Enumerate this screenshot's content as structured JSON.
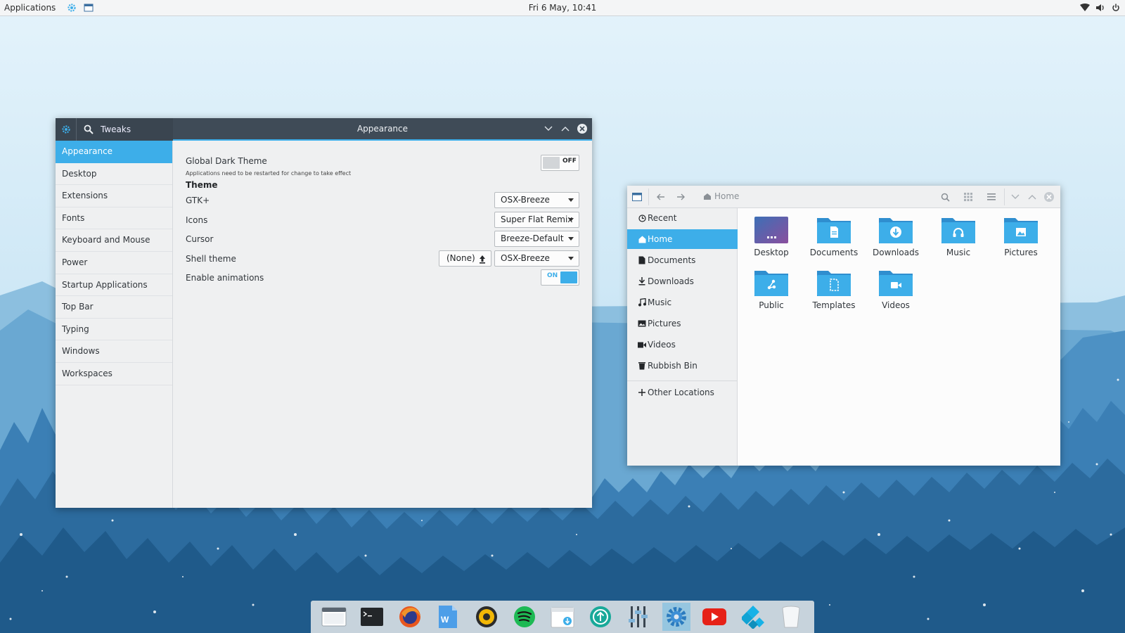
{
  "topbar": {
    "applications": "Applications",
    "clock": "Fri  6 May, 10:41",
    "icons": [
      "settings-icon",
      "files-icon",
      "wifi-icon",
      "volume-icon",
      "power-icon"
    ]
  },
  "tweaks": {
    "app_name": "Tweaks",
    "title": "Appearance",
    "sidebar": [
      {
        "label": "Appearance",
        "active": true
      },
      {
        "label": "Desktop"
      },
      {
        "label": "Extensions"
      },
      {
        "label": "Fonts"
      },
      {
        "label": "Keyboard and Mouse"
      },
      {
        "label": "Power"
      },
      {
        "label": "Startup Applications"
      },
      {
        "label": "Top Bar"
      },
      {
        "label": "Typing"
      },
      {
        "label": "Windows"
      },
      {
        "label": "Workspaces"
      }
    ],
    "global_dark_theme": {
      "label": "Global Dark Theme",
      "note": "Applications need to be restarted for change to take effect",
      "state": "OFF"
    },
    "theme_header": "Theme",
    "gtk": {
      "label": "GTK+",
      "value": "OSX-Breeze"
    },
    "icons": {
      "label": "Icons",
      "value": "Super Flat Remix"
    },
    "cursor": {
      "label": "Cursor",
      "value": "Breeze-Default"
    },
    "shell": {
      "label": "Shell theme",
      "button": "(None)",
      "value": "OSX-Breeze"
    },
    "animations": {
      "label": "Enable animations",
      "state": "ON"
    }
  },
  "files": {
    "location": "Home",
    "sidebar": [
      {
        "label": "Recent",
        "icon": "clock-icon"
      },
      {
        "label": "Home",
        "icon": "home-icon",
        "active": true
      },
      {
        "label": "Documents",
        "icon": "document-icon"
      },
      {
        "label": "Downloads",
        "icon": "download-icon"
      },
      {
        "label": "Music",
        "icon": "music-icon"
      },
      {
        "label": "Pictures",
        "icon": "picture-icon"
      },
      {
        "label": "Videos",
        "icon": "video-icon"
      },
      {
        "label": "Rubbish Bin",
        "icon": "trash-icon"
      }
    ],
    "other_locations": "Other Locations",
    "folders": [
      {
        "label": "Desktop",
        "icon": "desktop-folder-icon"
      },
      {
        "label": "Documents",
        "icon": "documents-folder-icon"
      },
      {
        "label": "Downloads",
        "icon": "downloads-folder-icon"
      },
      {
        "label": "Music",
        "icon": "music-folder-icon"
      },
      {
        "label": "Pictures",
        "icon": "pictures-folder-icon"
      },
      {
        "label": "Public",
        "icon": "public-folder-icon"
      },
      {
        "label": "Templates",
        "icon": "templates-folder-icon"
      },
      {
        "label": "Videos",
        "icon": "videos-folder-icon"
      }
    ]
  },
  "dock": [
    "files-icon",
    "terminal-icon",
    "firefox-icon",
    "writer-icon",
    "rhythmbox-icon",
    "spotify-icon",
    "calendar-icon",
    "update-icon",
    "mixer-icon",
    "settings-icon",
    "youtube-icon",
    "kodi-icon",
    "trash-icon"
  ],
  "colors": {
    "accent": "#3daee9",
    "titlebar": "#3f4b57",
    "sidebar": "#eff0f1"
  }
}
